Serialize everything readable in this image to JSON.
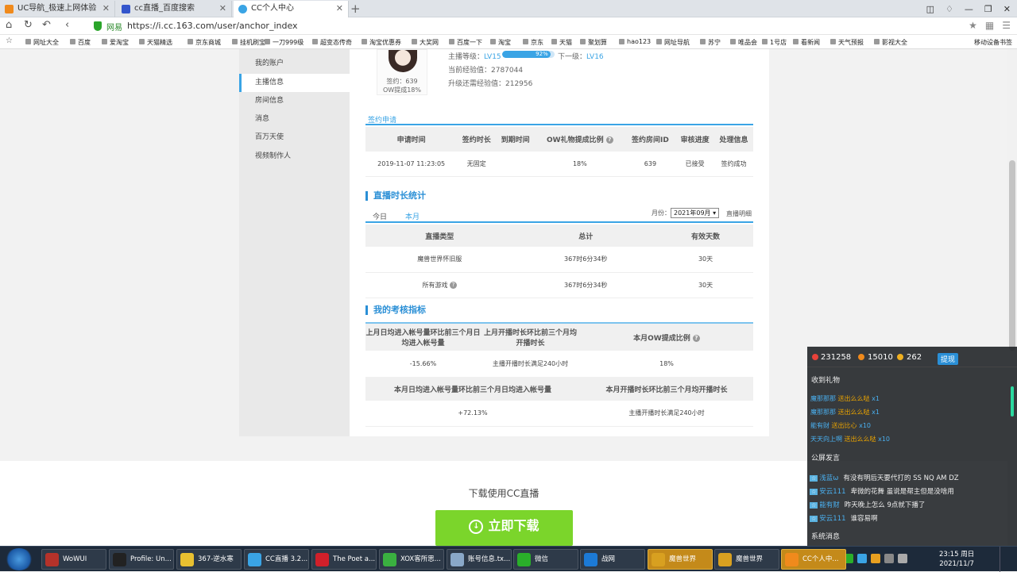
{
  "browser": {
    "tabs": [
      {
        "title": "UC导航_极速上网体验",
        "color": "#f08a1c"
      },
      {
        "title": "cc直播_百度搜索",
        "color": "#3355cc"
      },
      {
        "title": "CC个人中心",
        "color": "#3aa4e5"
      }
    ],
    "new_tab": "+",
    "site_badge": "网易",
    "url": "https://i.cc.163.com/user/anchor_index",
    "bookmarks": [
      "网址大全",
      "百度",
      "爱淘宝",
      "天猫精选",
      "京东商城",
      "挂机刷宝",
      "一刀999级",
      "超变态传奇",
      "淘宝优惠券",
      "大奖网",
      "百度一下",
      "淘宝",
      "京东",
      "天猫",
      "聚划算",
      "hao123",
      "网址导航",
      "苏宁",
      "唯品会",
      "1号店",
      "看新闻",
      "天气预报",
      "影视大全"
    ],
    "bookmarks_right": "移动设备书签"
  },
  "sidebar": {
    "items": [
      "我的账户",
      "主播信息",
      "房间信息",
      "消息",
      "百万天使",
      "视频制作人"
    ]
  },
  "profile": {
    "sign_label": "签约：639",
    "ow_label": "OW提成18%",
    "level_label": "主播等级：",
    "level_value": "LV15",
    "progress_text": "92%",
    "progress_fraction": 0.92,
    "next_level_label": "下一级：",
    "next_level_value": "LV16",
    "exp_current": "当前经验值：2787044",
    "exp_needed": "升级还需经验值：212956"
  },
  "contract": {
    "tab": "签约申请",
    "headers": [
      "申请时间",
      "签约时长",
      "到期时间",
      "OW礼物提成比例",
      "签约房间ID",
      "审核进度",
      "处理信息"
    ],
    "row": [
      "2019-11-07 11:23:05",
      "无固定",
      "",
      "18%",
      "639",
      "已接受",
      "签约成功"
    ]
  },
  "live_stats": {
    "title": "直播时长统计",
    "tabs": [
      "今日",
      "本月"
    ],
    "month_label": "月份：",
    "month_value": "2021年09月",
    "detail_link": "直播明细",
    "headers": [
      "直播类型",
      "总计",
      "有效天数"
    ],
    "rows": [
      [
        "魔兽世界怀旧服",
        "367时6分34秒",
        "30天"
      ],
      [
        "所有游戏",
        "367时6分34秒",
        "30天"
      ]
    ]
  },
  "assessment": {
    "title": "我的考核指标",
    "h1": [
      "上月日均进入帐号量环比前三个月日均进入帐号量",
      "上月开播时长环比前三个月均开播时长",
      "本月OW提成比例"
    ],
    "r1": [
      "-15.66%",
      "主播开播时长满足240小时",
      "18%"
    ],
    "h2": [
      "本月日均进入帐号量环比前三个月日均进入帐号量",
      "本月开播时长环比前三个月均开播时长"
    ],
    "r2": [
      "+72.13%",
      "主播开播时长满足240小时"
    ]
  },
  "footer": {
    "text": "下载使用CC直播",
    "button": "立即下载"
  },
  "overlay": {
    "stat1": "231258",
    "stat2": "15010",
    "stat3": "262",
    "withdraw": "提现",
    "gifts_title": "收到礼物",
    "gifts": [
      {
        "user": "魔那那那",
        "gift": "送出么么哒",
        "count": "x1"
      },
      {
        "user": "魔那那那",
        "gift": "送出么么哒",
        "count": "x1"
      },
      {
        "user": "能有财",
        "gift": "送出比心",
        "count": "x10"
      },
      {
        "user": "天天向上啊",
        "gift": "送出么么哒",
        "count": "x10"
      }
    ],
    "chat_title": "公屏发言",
    "chats": [
      {
        "user": "浅蓝ω",
        "text": "有没有明后天要代打的 SS NQ AM DZ"
      },
      {
        "user": "安云111",
        "text": "卑微的花舞 虽说是帮主但是没啥用"
      },
      {
        "user": "能有财",
        "text": "昨天晚上怎么 9点就下播了"
      },
      {
        "user": "安云111",
        "text": "谁容易啊"
      }
    ],
    "sys_title": "系统消息"
  },
  "taskbar": {
    "items": [
      {
        "label": "WoWUI",
        "color": "#b5322a"
      },
      {
        "label": "Profile: Un...",
        "color": "#222"
      },
      {
        "label": "367-逆水寒",
        "color": "#e8c030"
      },
      {
        "label": "CC直播 3.2...",
        "color": "#3aa4e5"
      },
      {
        "label": "The Poet a...",
        "color": "#d0202a"
      },
      {
        "label": "XOX客所思...",
        "color": "#3ab040"
      },
      {
        "label": "账号信息.tx...",
        "color": "#8aa8c8"
      },
      {
        "label": "微信",
        "color": "#2aae2a"
      },
      {
        "label": "战网",
        "color": "#1c7ad6"
      },
      {
        "label": "魔兽世界",
        "color": "#d8a020"
      },
      {
        "label": "魔兽世界",
        "color": "#d8a020"
      },
      {
        "label": "CC个人中...",
        "color": "#f08a1c"
      }
    ],
    "time": "23:15 周日",
    "date": "2021/11/7"
  }
}
